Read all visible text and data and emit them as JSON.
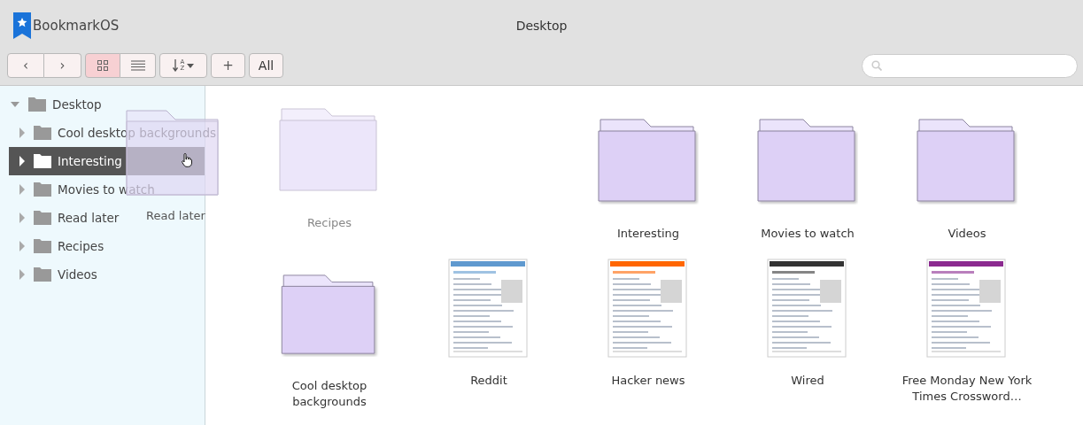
{
  "app": {
    "name": "BookmarkOS"
  },
  "window": {
    "title": "Desktop"
  },
  "toolbar": {
    "nav": [
      {
        "label": "‹"
      },
      {
        "label": "›"
      }
    ],
    "views": [
      {
        "kind": "grid",
        "selected": true
      },
      {
        "kind": "list",
        "selected": false
      }
    ],
    "sort": {
      "letters": [
        "A",
        "Z"
      ]
    },
    "add": "+",
    "all": "All"
  },
  "sidebar": {
    "tree": [
      {
        "label": "Desktop",
        "expanded": true,
        "selected": false,
        "children": [
          {
            "label": "Cool desktop backgrounds",
            "expanded": false,
            "selected": false
          },
          {
            "label": "Interesting",
            "expanded": false,
            "selected": true
          },
          {
            "label": "Movies to watch",
            "expanded": false,
            "selected": false
          },
          {
            "label": "Read later",
            "expanded": false,
            "selected": false
          },
          {
            "label": "Recipes",
            "expanded": false,
            "selected": false
          },
          {
            "label": "Videos",
            "expanded": false,
            "selected": false
          }
        ]
      }
    ],
    "drag_label": "Read later"
  },
  "items": [
    {
      "kind": "folder",
      "label": "Recipes",
      "faded": true
    },
    {
      "kind": "gap"
    },
    {
      "kind": "folder",
      "label": "Interesting",
      "faded": false
    },
    {
      "kind": "folder",
      "label": "Movies to watch",
      "faded": false
    },
    {
      "kind": "folder",
      "label": "Videos",
      "faded": false
    },
    {
      "kind": "folder",
      "label": "Cool desktop backgrounds",
      "faded": false
    },
    {
      "kind": "page",
      "label": "Reddit",
      "color": "#5f99cf"
    },
    {
      "kind": "page",
      "label": "Hacker news",
      "color": "#ff6600"
    },
    {
      "kind": "page",
      "label": "Wired",
      "color": "#333333"
    },
    {
      "kind": "page",
      "label": "Free Monday New York Times Crossword…",
      "color": "#8b2a8f"
    }
  ]
}
